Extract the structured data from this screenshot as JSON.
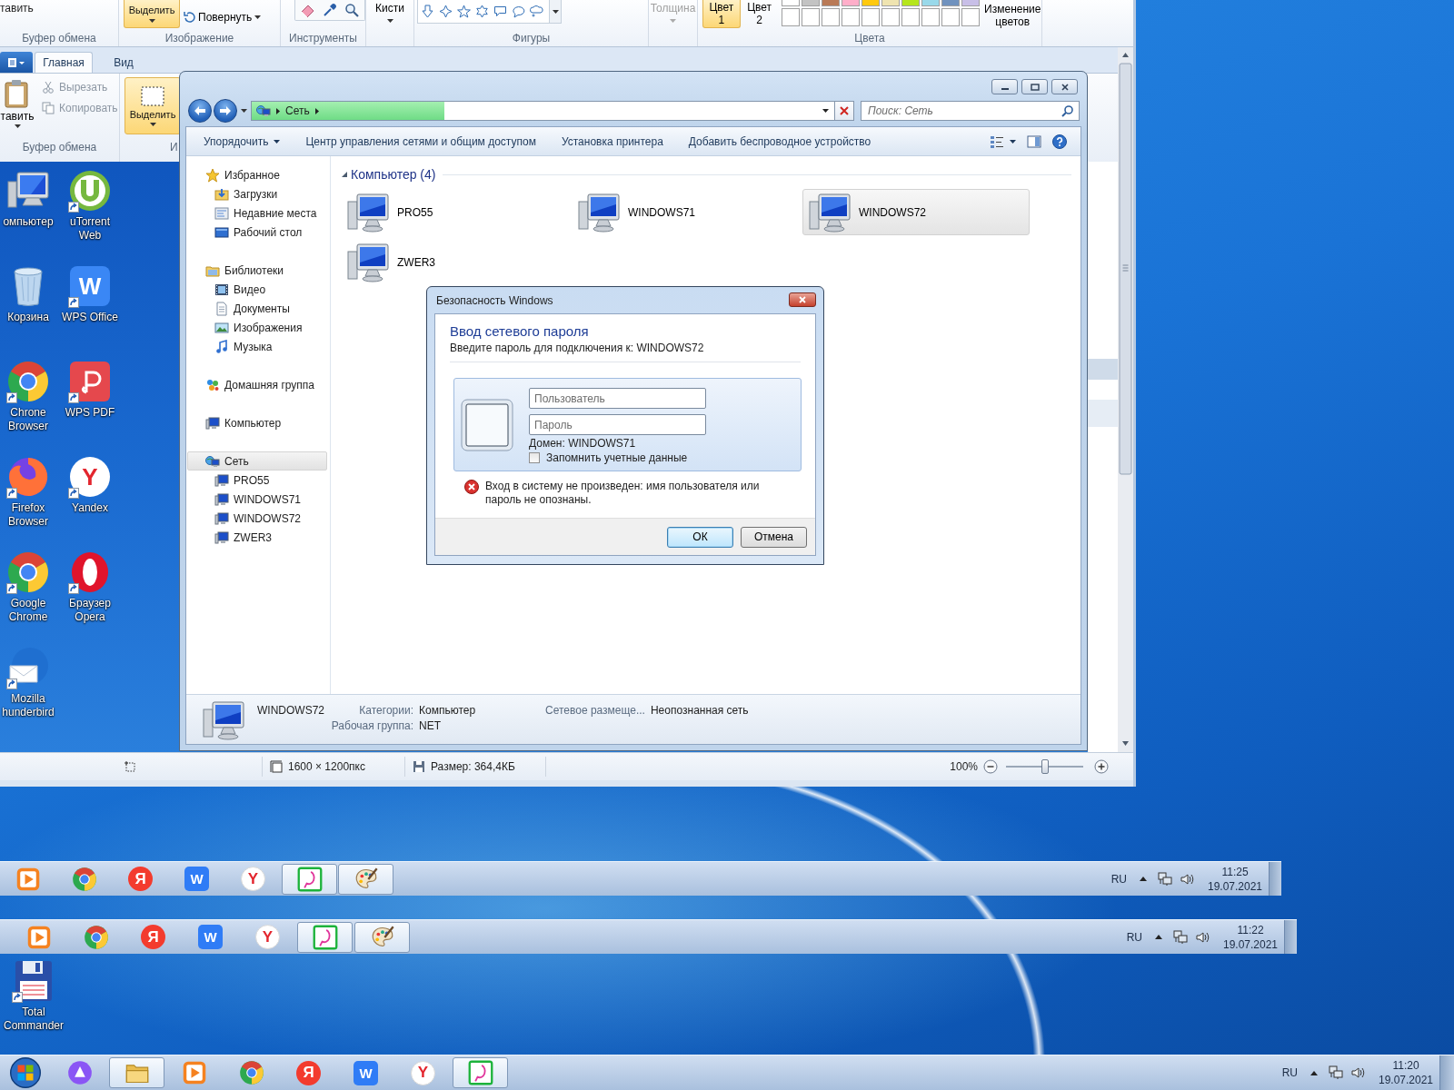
{
  "paint_window": {
    "ribbon": {
      "paste_label": "тавить",
      "clipboard_group": "Буфер обмена",
      "select_label": "Выделить",
      "rotate_label": "Повернуть",
      "image_group": "Изображение",
      "tools_group": "Инструменты",
      "brushes_label": "Кисти",
      "shapes_group": "Фигуры",
      "size": {
        "label": "Толщина",
        "disabled": true
      },
      "color_buttons": [
        {
          "label": "Цвет 1",
          "selected": true
        },
        {
          "label": "Цвет 2",
          "selected": false
        }
      ],
      "palette_rows": [
        [
          {
            "color": "#ffffff"
          },
          {
            "color": "#c3c3c3"
          },
          {
            "color": "#b97a57"
          },
          {
            "color": "#ffaec9"
          },
          {
            "color": "#ffc90e"
          },
          {
            "color": "#efe4b0"
          },
          {
            "color": "#b5e61d"
          },
          {
            "color": "#99d9ea"
          },
          {
            "color": "#7092be"
          },
          {
            "color": "#c8bfe7"
          }
        ],
        [
          {
            "color": "#ffffff"
          },
          {
            "color": "#ffffff"
          },
          {
            "color": "#ffffff"
          },
          {
            "color": "#ffffff"
          },
          {
            "color": "#ffffff"
          },
          {
            "color": "#ffffff"
          },
          {
            "color": "#ffffff"
          },
          {
            "color": "#ffffff"
          },
          {
            "color": "#ffffff"
          },
          {
            "color": "#ffffff"
          }
        ]
      ],
      "edit_colors_label": "Изменение цветов",
      "colors_group": "Цвета"
    },
    "status_bar": {
      "dimensions": "1600 × 1200пкс",
      "file_size": "Размер: 364,4КБ",
      "zoom": "100%",
      "zoom_slider": {
        "level": 0.5
      }
    }
  },
  "inner_paint_window": {
    "tabs": [
      {
        "label": "Главная",
        "selected": true
      },
      {
        "label": "Вид",
        "selected": false
      }
    ],
    "paste_label": "тавить",
    "clipboard_actions": [
      {
        "kind": "cut",
        "label": "Вырезать",
        "disabled": true
      },
      {
        "kind": "copy",
        "label": "Копировать",
        "disabled": true
      }
    ],
    "clipboard_group": "Буфер обмена",
    "select_label": "Выделить",
    "image_group": "И"
  },
  "desktop_icons": [
    {
      "label": "омпьютер",
      "kind": "computer",
      "shortcut": false
    },
    {
      "label": "Корзина",
      "kind": "trash",
      "shortcut": false
    },
    {
      "label": "Chrone Browser",
      "kind": "chrome",
      "shortcut": true
    },
    {
      "label": "Firefox Browser",
      "kind": "firefox",
      "shortcut": true
    },
    {
      "label": "Google Chrome",
      "kind": "chrome",
      "shortcut": true
    },
    {
      "label": "Mozilla hunderbird",
      "kind": "thunderbird",
      "shortcut": true
    },
    {
      "label": "uTorrent Web",
      "kind": "utorrent",
      "shortcut": true
    },
    {
      "label": "WPS Office",
      "kind": "wps",
      "glyph": "W",
      "shortcut": true
    },
    {
      "label": "WPS PDF",
      "kind": "wps_pdf",
      "shortcut": true
    },
    {
      "label": "Yandex",
      "kind": "yandex",
      "glyph": "Y",
      "shortcut": true
    },
    {
      "label": "Браузер Opera",
      "kind": "opera",
      "shortcut": true
    }
  ],
  "explorer": {
    "address": {
      "crumbs": [
        "Сеть"
      ],
      "level": 0.33
    },
    "search": {
      "placeholder": "Поиск: Сеть"
    },
    "toolbar": [
      {
        "label": "Упорядочить",
        "menu": true
      },
      {
        "label": "Центр управления сетями и общим доступом",
        "menu": false
      },
      {
        "label": "Установка принтера",
        "menu": false
      },
      {
        "label": "Добавить беспроводное устройство",
        "menu": false
      }
    ],
    "nav": [
      {
        "label": "Избранное",
        "kind": "favorites",
        "selected": false,
        "children": [
          {
            "label": "Загрузки",
            "kind": "downloads",
            "selected": false
          },
          {
            "label": "Недавние места",
            "kind": "recent",
            "selected": false
          },
          {
            "label": "Рабочий стол",
            "kind": "desktop",
            "selected": false
          }
        ]
      },
      {
        "label": "Библиотеки",
        "kind": "libraries",
        "selected": false,
        "children": [
          {
            "label": "Видео",
            "kind": "video",
            "selected": false
          },
          {
            "label": "Документы",
            "kind": "documents",
            "selected": false
          },
          {
            "label": "Изображения",
            "kind": "pictures",
            "selected": false
          },
          {
            "label": "Музыка",
            "kind": "music",
            "selected": false
          }
        ]
      },
      {
        "label": "Домашняя группа",
        "kind": "homegroup",
        "selected": false
      },
      {
        "label": "Компьютер",
        "kind": "computer",
        "selected": false
      },
      {
        "label": "Сеть",
        "kind": "network",
        "selected": true,
        "children": [
          {
            "label": "PRO55",
            "kind": "computer",
            "selected": false
          },
          {
            "label": "WINDOWS71",
            "kind": "computer",
            "selected": false
          },
          {
            "label": "WINDOWS72",
            "kind": "computer",
            "selected": false
          },
          {
            "label": "ZWER3",
            "kind": "computer",
            "selected": false
          }
        ]
      }
    ],
    "content": {
      "group_label": "Компьютер (4)",
      "expanded": true,
      "items": [
        {
          "label": "PRO55",
          "selected": false
        },
        {
          "label": "WINDOWS71",
          "selected": false
        },
        {
          "label": "WINDOWS72",
          "selected": true
        },
        {
          "label": "ZWER3",
          "selected": false
        }
      ]
    },
    "details": {
      "name": "WINDOWS72",
      "fields": [
        {
          "label": "Категории:",
          "value": "Компьютер"
        },
        {
          "label": "Рабочая группа:",
          "value": "NET"
        },
        {
          "label": "Сетевое размеще...",
          "value": "Неопознанная сеть"
        }
      ]
    }
  },
  "dialog": {
    "title": "Безопасность Windows",
    "heading": "Ввод сетевого пароля",
    "prompt": "Введите пароль для подключения к: WINDOWS72",
    "user_field": {
      "placeholder": "Пользователь"
    },
    "password_field": {
      "placeholder": "Пароль"
    },
    "domain": "Домен: WINDOWS71",
    "remember": {
      "label": "Запомнить учетные данные",
      "checked": false
    },
    "error": "Вход в систему не произведен: имя пользователя или пароль не опознаны.",
    "buttons": [
      {
        "label": "ОК",
        "default": true
      },
      {
        "label": "Отмена",
        "default": false
      }
    ]
  },
  "taskbars": [
    {
      "items": [
        {
          "kind": "media",
          "running": false
        },
        {
          "kind": "chrome",
          "running": false
        },
        {
          "kind": "ya",
          "glyph": "Я",
          "running": false
        },
        {
          "kind": "wps",
          "glyph": "W",
          "running": false
        },
        {
          "kind": "yandex",
          "glyph": "Y",
          "running": false
        },
        {
          "kind": "messenger",
          "running": true
        },
        {
          "kind": "paint",
          "running": true
        }
      ],
      "language": "RU",
      "time": "11:25",
      "date": "19.07.2021"
    },
    {
      "items": [
        {
          "kind": "media",
          "running": false
        },
        {
          "kind": "chrome",
          "running": false
        },
        {
          "kind": "ya",
          "glyph": "Я",
          "running": false
        },
        {
          "kind": "wps",
          "glyph": "W",
          "running": false
        },
        {
          "kind": "yandex",
          "glyph": "Y",
          "running": false
        },
        {
          "kind": "messenger",
          "running": true
        },
        {
          "kind": "paint",
          "running": true
        }
      ],
      "language": "RU",
      "time": "11:22",
      "date": "19.07.2021"
    },
    {
      "items": [
        {
          "kind": "start",
          "running": false
        },
        {
          "kind": "alice",
          "running": false
        },
        {
          "kind": "explorer",
          "running": true
        },
        {
          "kind": "media",
          "running": false
        },
        {
          "kind": "chrome",
          "running": false
        },
        {
          "kind": "ya",
          "glyph": "Я",
          "running": false
        },
        {
          "kind": "wps",
          "glyph": "W",
          "running": false
        },
        {
          "kind": "yandex",
          "glyph": "Y",
          "running": false
        },
        {
          "kind": "messenger",
          "running": true
        }
      ],
      "language": "RU",
      "time": "11:20",
      "date": "19.07.2021"
    }
  ],
  "outer_desktop_icons": [
    {
      "label": "Total Commander",
      "kind": "floppy",
      "shortcut": true
    }
  ]
}
